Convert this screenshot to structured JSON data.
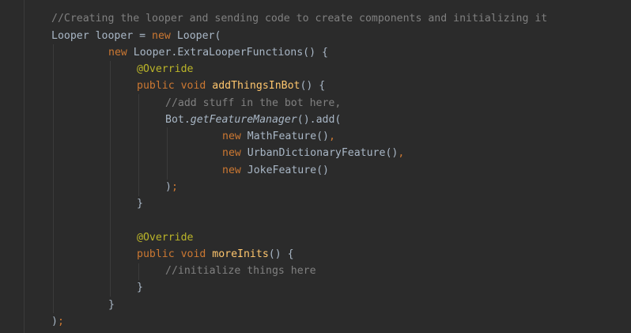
{
  "colors": {
    "background": "#2b2b2b",
    "default_text": "#a9b7c6",
    "keyword": "#cc7832",
    "annotation": "#bbb529",
    "comment": "#808080",
    "method_declaration": "#ffc66d",
    "indent_guide": "#3b3b3b"
  },
  "code": {
    "line1": {
      "comment": "//Creating the looper and sending code to create components and initializing it"
    },
    "line2": {
      "a": "Looper looper = ",
      "kw": "new",
      "b": " Looper("
    },
    "line3": {
      "kw": "new",
      "a": " Looper.ExtraLooperFunctions() {"
    },
    "line4": {
      "ann": "@Override"
    },
    "line5": {
      "kw": "public void",
      "sp": " ",
      "fn": "addThingsInBot",
      "b": "() {"
    },
    "line6": {
      "comment": "//add stuff in the bot here,"
    },
    "line7": {
      "a": "Bot.",
      "it": "getFeatureManager",
      "b": "().add("
    },
    "line8": {
      "kw": "new",
      "a": " MathFeature()",
      "punc": ","
    },
    "line9": {
      "kw": "new",
      "a": " UrbanDictionaryFeature()",
      "punc": ","
    },
    "line10": {
      "kw": "new",
      "a": " JokeFeature()"
    },
    "line11": {
      "a": ")",
      "punc": ";"
    },
    "line12": {
      "a": "}"
    },
    "line13": {
      "ann": "@Override"
    },
    "line14": {
      "kw": "public void",
      "sp": " ",
      "fn": "moreInits",
      "b": "() {"
    },
    "line15": {
      "comment": "//initialize things here"
    },
    "line16": {
      "a": "}"
    },
    "line17": {
      "a": "}"
    },
    "line18": {
      "a": ")",
      "punc": ";"
    }
  }
}
